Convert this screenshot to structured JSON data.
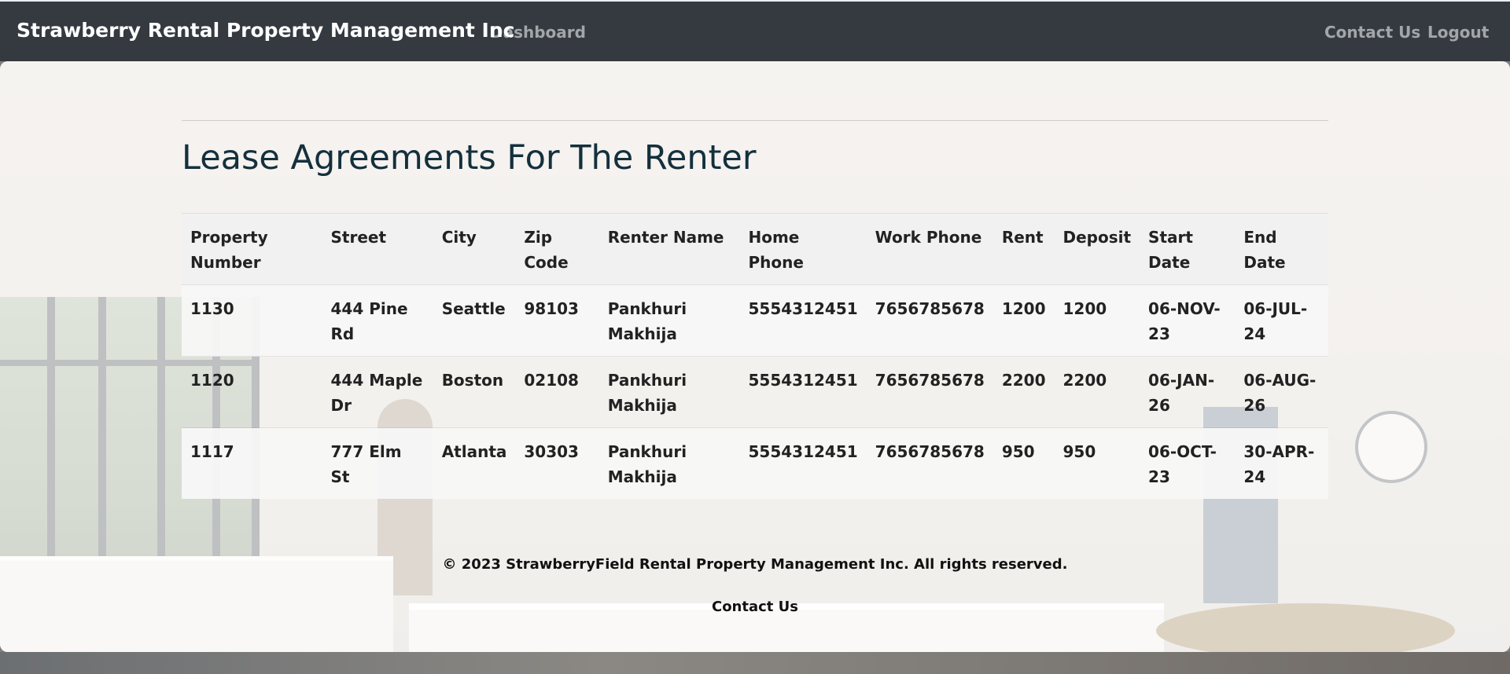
{
  "navbar": {
    "brand": "Strawberry Rental Property Management Inc",
    "links": {
      "dashboard": "Dashboard",
      "contact": "Contact Us",
      "logout": "Logout"
    }
  },
  "main": {
    "title": "Lease Agreements For The Renter",
    "table": {
      "headers": [
        "Property Number",
        "Street",
        "City",
        "Zip Code",
        "Renter Name",
        "Home Phone",
        "Work Phone",
        "Rent",
        "Deposit",
        "Start Date",
        "End Date"
      ],
      "rows": [
        [
          "1130",
          "444 Pine Rd",
          "Seattle",
          "98103",
          "Pankhuri Makhija",
          "5554312451",
          "7656785678",
          "1200",
          "1200",
          "06-NOV-23",
          "06-JUL-24"
        ],
        [
          "1120",
          "444 Maple Dr",
          "Boston",
          "02108",
          "Pankhuri Makhija",
          "5554312451",
          "7656785678",
          "2200",
          "2200",
          "06-JAN-26",
          "06-AUG-26"
        ],
        [
          "1117",
          "777 Elm St",
          "Atlanta",
          "30303",
          "Pankhuri Makhija",
          "5554312451",
          "7656785678",
          "950",
          "950",
          "06-OCT-23",
          "30-APR-24"
        ]
      ]
    }
  },
  "footer": {
    "copyright": "© 2023 StrawberryField Rental Property Management Inc. All rights reserved.",
    "contact_link": "Contact Us"
  },
  "colors": {
    "navbar_bg": "#343a40",
    "title_color": "#14303d"
  }
}
